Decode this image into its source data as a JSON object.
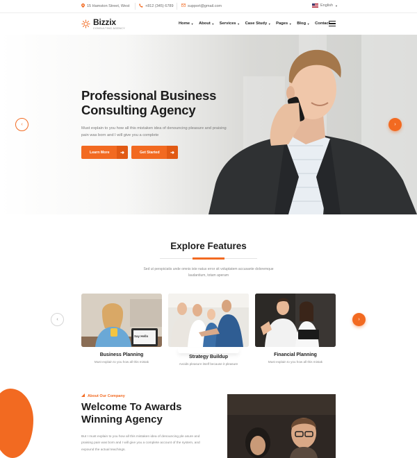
{
  "topbar": {
    "address": "15 Hamston Street, West",
    "phone": "+812 (345) 6789",
    "email": "support@gmail.com",
    "language": "English"
  },
  "brand": {
    "name": "Bizzix",
    "tagline": "CONSULTING AGENCY"
  },
  "nav": {
    "items": [
      {
        "label": "Home",
        "dropdown": true
      },
      {
        "label": "About",
        "dropdown": true
      },
      {
        "label": "Services",
        "dropdown": true
      },
      {
        "label": "Case Study",
        "dropdown": true
      },
      {
        "label": "Pages",
        "dropdown": true
      },
      {
        "label": "Blog",
        "dropdown": true
      },
      {
        "label": "Contact",
        "dropdown": false
      }
    ]
  },
  "hero": {
    "title_line1": "Professional Business",
    "title_line2": "Consulting Agency",
    "text": "Must explain to you how all this mistaken idea of denouncing pleasure and praising pain was born and I will give you a complete",
    "btn_primary": "Learn More",
    "btn_secondary": "Get Started"
  },
  "features": {
    "title": "Explore Features",
    "subtitle": "Sed ut perspiciatis unde omnis iste natus error sit voluptatem accusante doloremque laudantium, totam aperam",
    "cards": [
      {
        "title": "Business Planning",
        "text": "Must explain to you how all this mistak",
        "badge": "Say Hello"
      },
      {
        "title": "Strategy Buildup",
        "text": "Avoids pleasure itself because it pleasure"
      },
      {
        "title": "Financial Planning",
        "text": "Must explain to you how all this mistak"
      }
    ]
  },
  "about": {
    "kicker": "About Our Company",
    "title_line1": "Welcome To Awards",
    "title_line2": "Winning Agency",
    "text": "But I must explain to you how all this mistaken idea of denouncing ple asure and praising pain was born and I will give you a complete account of the system, and expound the actual teachings."
  },
  "colors": {
    "accent": "#f26a21",
    "heading": "#1c1c1c",
    "body_text": "#777777"
  }
}
